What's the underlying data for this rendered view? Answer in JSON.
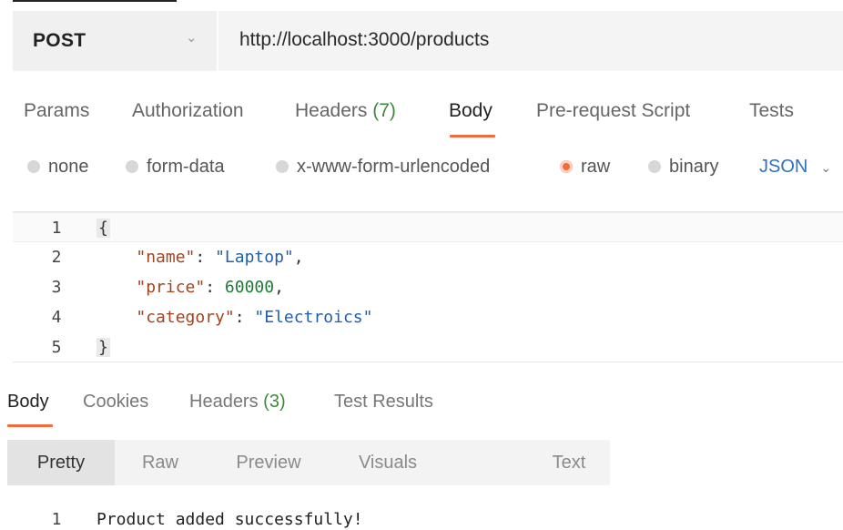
{
  "request": {
    "method": "POST",
    "url": "http://localhost:3000/products",
    "chevron_icon": "chevron-down-icon"
  },
  "request_tabs": [
    {
      "label": "Params"
    },
    {
      "label": "Authorization"
    },
    {
      "label": "Headers",
      "count": "(7)"
    },
    {
      "label": "Body",
      "active": true
    },
    {
      "label": "Pre-request Script"
    },
    {
      "label": "Tests"
    }
  ],
  "body_types": [
    {
      "label": "none",
      "selected": false
    },
    {
      "label": "form-data",
      "selected": false
    },
    {
      "label": "x-www-form-urlencoded",
      "selected": false
    },
    {
      "label": "raw",
      "selected": true
    },
    {
      "label": "binary",
      "selected": false
    }
  ],
  "raw_language": "JSON",
  "editor": {
    "lines": [
      {
        "num": "1",
        "open": "{"
      },
      {
        "num": "2",
        "key": "\"name\"",
        "sep": ": ",
        "str": "\"Laptop\"",
        "end": ","
      },
      {
        "num": "3",
        "key": "\"price\"",
        "sep": ": ",
        "num_val": "60000",
        "end": ","
      },
      {
        "num": "4",
        "key": "\"category\"",
        "sep": ": ",
        "str": "\"Electroics\"",
        "end": ""
      },
      {
        "num": "5",
        "close": "}"
      }
    ]
  },
  "response_tabs": [
    {
      "label": "Body",
      "active": true
    },
    {
      "label": "Cookies"
    },
    {
      "label": "Headers",
      "count": "(3)"
    },
    {
      "label": "Test Results"
    }
  ],
  "views": [
    {
      "label": "Pretty",
      "active": true
    },
    {
      "label": "Raw"
    },
    {
      "label": "Preview"
    },
    {
      "label": "Visuals"
    },
    {
      "label": "Text"
    }
  ],
  "response_body": [
    {
      "num": "1",
      "text": "Product added successfully!"
    }
  ],
  "colors": {
    "accent": "#f26b3a",
    "link_blue": "#2d72c7",
    "count_green": "#3c8a3c",
    "json_key": "#a3431f",
    "json_string": "#1d5fb0",
    "json_number": "#1f7a38"
  }
}
